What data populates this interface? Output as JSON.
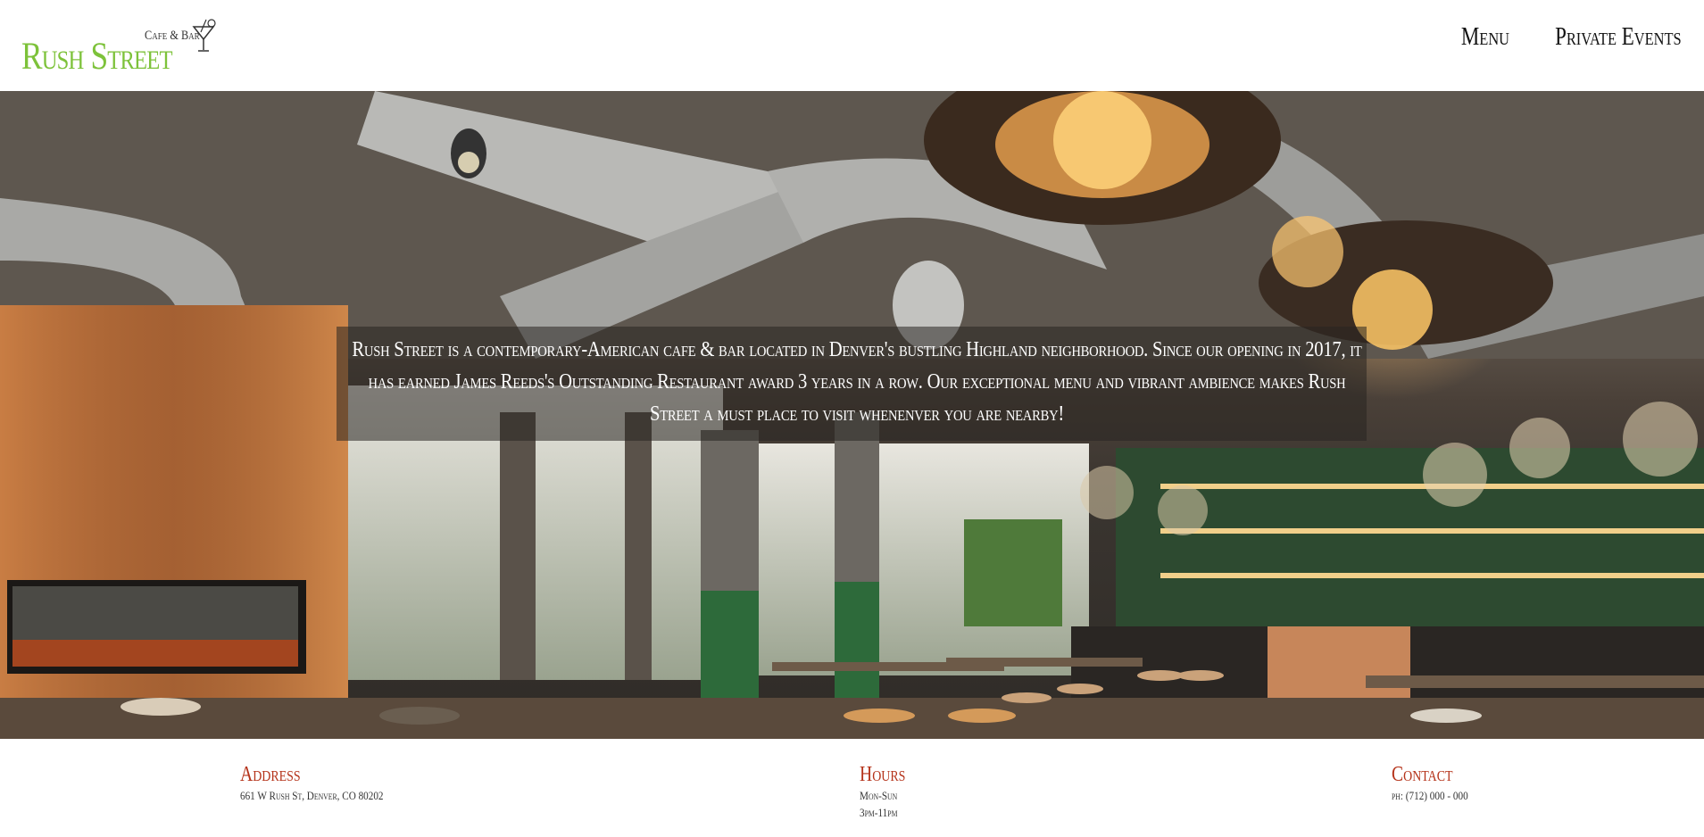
{
  "brand": {
    "name": "Rush Street",
    "subtitle": "Cafe & Bar",
    "name_color": "#7dc23a",
    "icon": "cocktail-glass-icon"
  },
  "nav": {
    "items": [
      {
        "label": "Menu"
      },
      {
        "label": "Private Events"
      }
    ]
  },
  "hero": {
    "image": "restaurant-interior-photo",
    "caption": "Rush Street is a contemporary-American cafe & bar located in Denver's bustling Highland neighborhood. Since our opening in 2017, it has earned James Reeds's Outstanding Restaurant award 3 years in a row. Our exceptional menu and vibrant ambience makes Rush Street a must place to visit whenenver you are nearby!"
  },
  "footer": {
    "heading_color": "#b5331a",
    "address": {
      "heading": "Address",
      "line1": "661 W Rush St, Denver, CO 80202"
    },
    "hours": {
      "heading": "Hours",
      "line1": "Mon-Sun",
      "line2": "3pm-11pm"
    },
    "contact": {
      "heading": "Contact",
      "line1": "ph: (712) 000 - 000"
    }
  }
}
